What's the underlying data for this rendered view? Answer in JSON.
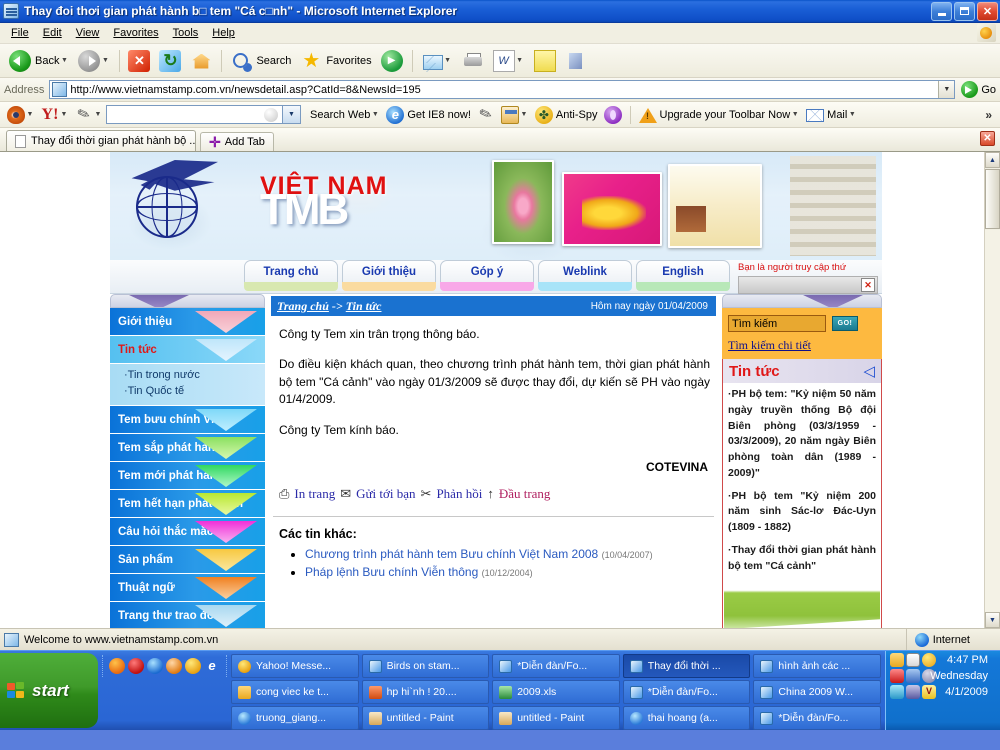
{
  "window": {
    "title": "Thay đoi thơi gian phát hành b□ tem \"Cá c□nh\" - Microsoft Internet Explorer",
    "icon": "ie-document-icon",
    "minimize": "minimize-button",
    "maximize": "maximize-button",
    "close": "close-button"
  },
  "menubar": {
    "items": [
      "File",
      "Edit",
      "View",
      "Favorites",
      "Tools",
      "Help"
    ]
  },
  "toolbar": {
    "back": "Back",
    "search": "Search",
    "favorites": "Favorites",
    "items": [
      {
        "name": "back-button",
        "label": "Back",
        "icon": "back-arrow-icon",
        "dropdown": true
      },
      {
        "name": "forward-button",
        "label": "",
        "icon": "forward-arrow-icon",
        "dropdown": true
      },
      {
        "name": "stop-button",
        "label": "",
        "icon": "stop-icon"
      },
      {
        "name": "refresh-button",
        "label": "",
        "icon": "refresh-icon"
      },
      {
        "name": "home-button",
        "label": "",
        "icon": "home-icon"
      },
      {
        "name": "search-button",
        "label": "Search",
        "icon": "search-icon"
      },
      {
        "name": "favorites-button",
        "label": "Favorites",
        "icon": "star-icon"
      },
      {
        "name": "media-button",
        "label": "",
        "icon": "media-icon"
      },
      {
        "name": "mail-button",
        "label": "",
        "icon": "mail-icon",
        "dropdown": true
      },
      {
        "name": "print-button",
        "label": "",
        "icon": "printer-icon"
      },
      {
        "name": "word-button",
        "label": "",
        "icon": "word-icon",
        "dropdown": true
      },
      {
        "name": "notes-button",
        "label": "",
        "icon": "note-icon"
      },
      {
        "name": "edit-button",
        "label": "",
        "icon": "edit-icon"
      }
    ]
  },
  "address": {
    "label": "Address",
    "url": "http://www.vietnamstamp.com.vn/newsdetail.asp?CatId=8&NewsId=195",
    "go_label": "Go"
  },
  "yahoo_toolbar": {
    "search_placeholder": "",
    "search_value": "",
    "search_web": "Search Web",
    "items": [
      {
        "name": "yahoo-companion-icon",
        "label": ""
      },
      {
        "name": "yahoo-logo-icon",
        "label": ""
      },
      {
        "name": "highlight-pen-icon",
        "label": ""
      },
      {
        "name": "get-ie8-button",
        "label": "Get IE8 now!"
      },
      {
        "name": "pencil-icon",
        "label": ""
      },
      {
        "name": "popup-blocker-icon",
        "label": ""
      },
      {
        "name": "anti-spy-button",
        "label": "Anti-Spy"
      },
      {
        "name": "music-icon",
        "label": ""
      },
      {
        "name": "upgrade-toolbar-button",
        "label": "Upgrade your Toolbar Now"
      },
      {
        "name": "mail-button",
        "label": "Mail"
      }
    ],
    "overflow": "»"
  },
  "tabs": {
    "open": [
      {
        "label": "Thay đổi thời gian phát hành bộ ...",
        "active": true
      }
    ],
    "add_tab": "Add Tab",
    "close_label": "✕"
  },
  "page": {
    "logo": {
      "line1": "VIỆT NAM",
      "line2": "TMB"
    },
    "nav": [
      {
        "label": "Trang chủ",
        "color": "#d8e8b0"
      },
      {
        "label": "Giới thiệu",
        "color": "#fadba0"
      },
      {
        "label": "Góp ý",
        "color": "#f8a8e8"
      },
      {
        "label": "Weblink",
        "color": "#a8e4f8"
      },
      {
        "label": "English",
        "color": "#b8e8b8"
      }
    ],
    "counter_text": "Bạn là người truy cập thứ",
    "counter_broken_image": "✕",
    "sidebar": [
      {
        "label": "Giới thiệu",
        "active": false,
        "arrow": "#f0a8b8"
      },
      {
        "label": "Tin tức",
        "active": true,
        "arrow": "#a8d8f8",
        "sub": [
          "Tin trong nước",
          "Tin Quốc tế"
        ]
      },
      {
        "label": "Tem bưu chính VN",
        "active": false,
        "arrow": "#7fd8f8"
      },
      {
        "label": "Tem sắp phát hành",
        "active": false,
        "arrow": "#8ae060"
      },
      {
        "label": "Tem mới phát hành",
        "active": false,
        "arrow": "#30d860"
      },
      {
        "label": "Tem hết hạn phát hành",
        "active": false,
        "arrow": "#b8e830"
      },
      {
        "label": "Câu hỏi thắc mắc",
        "active": false,
        "arrow": "#f030d8"
      },
      {
        "label": "Sản phẩm",
        "active": false,
        "arrow": "#f8c840"
      },
      {
        "label": "Thuật ngữ",
        "active": false,
        "arrow": "#f08020"
      },
      {
        "label": "Trang thư trao đổi",
        "active": false,
        "arrow": "#a8d8f0"
      }
    ],
    "breadcrumb": {
      "home": "Trang chủ",
      "sep": " -> ",
      "current": "Tin tức"
    },
    "today": "Hôm nay ngày 01/04/2009",
    "article": [
      "Công ty Tem xin trân trọng thông báo.",
      "Do điều kiện khách quan, theo chương trình phát hành tem, thời gian phát hành bộ tem \"Cá cảnh\" vào ngày 01/3/2009 sẽ được thay đổi, dự kiến sẽ PH vào ngày 01/4/2009.",
      "Công ty Tem kính báo."
    ],
    "signature": "COTEVINA",
    "actions": [
      {
        "icon": "printer-icon",
        "glyph": "⎙",
        "label": "In trang",
        "color": "blue"
      },
      {
        "icon": "envelope-icon",
        "glyph": "✉",
        "label": "Gửi tới bạn",
        "color": "blue"
      },
      {
        "icon": "paperclip-icon",
        "glyph": "✂",
        "label": "Phản hồi",
        "color": "blue"
      },
      {
        "icon": "up-arrow-icon",
        "glyph": "↑",
        "label": "Đầu trang",
        "color": "pink"
      }
    ],
    "others_title": "Các tin khác:",
    "others": [
      {
        "label": "Chương trình phát hành tem Bưu chính Việt Nam 2008",
        "date": "(10/04/2007)"
      },
      {
        "label": "Pháp lệnh Bưu chính Viễn thông",
        "date": "(10/12/2004)"
      }
    ],
    "search": {
      "value": "Tìm kiếm",
      "go": "GO!",
      "detail_link": "Tìm kiếm chi tiết"
    },
    "news_panel": {
      "title": "Tin tức",
      "flag_icon": "flag-icon",
      "items": [
        "PH bộ tem: \"Kỷ niệm 50 năm ngày truyền thống Bộ đội Biên phòng (03/3/1959 - 03/3/2009), 20 năm ngày Biên phòng toàn dân (1989 - 2009)\"",
        "PH bộ tem \"Kỷ niệm 200 năm sinh Sác-lơ Đác-Uyn (1809 - 1882)",
        "Thay đổi thời gian phát hành bộ tem \"Cá cảnh\""
      ]
    }
  },
  "statusbar": {
    "text": "Welcome to www.vietnamstamp.com.vn",
    "zone": "Internet"
  },
  "taskbar": {
    "start": "start",
    "quicklaunch": [
      "firefox-icon",
      "opera-icon",
      "ie-icon",
      "realplayer-icon",
      "yahoo-messenger-icon",
      "ie-browser-icon"
    ],
    "buttons": [
      {
        "label": "Yahoo! Messe...",
        "icon": "ym",
        "active": false
      },
      {
        "label": "Birds on stam...",
        "icon": "ie",
        "active": false
      },
      {
        "label": "*Diễn đàn/Fo...",
        "icon": "ie",
        "active": false
      },
      {
        "label": "Thay đổi thời ...",
        "icon": "ie",
        "active": true
      },
      {
        "label": "hình ảnh các ...",
        "icon": "ie",
        "active": false
      },
      {
        "label": "cong viec ke t...",
        "icon": "fold",
        "active": false
      },
      {
        "label": "hp hi`nh ! 20....",
        "icon": "cam",
        "active": false
      },
      {
        "label": "2009.xls",
        "icon": "xls",
        "active": false
      },
      {
        "label": "*Diễn đàn/Fo...",
        "icon": "ie",
        "active": false
      },
      {
        "label": "China 2009 W...",
        "icon": "ie",
        "active": false
      },
      {
        "label": "truong_giang...",
        "icon": "ym2",
        "active": false
      },
      {
        "label": "untitled - Paint",
        "icon": "paint",
        "active": false
      },
      {
        "label": "untitled - Paint",
        "icon": "paint",
        "active": false
      },
      {
        "label": "thai hoang (a...",
        "icon": "ym2",
        "active": false
      },
      {
        "label": "*Diễn đàn/Fo...",
        "icon": "ie",
        "active": false
      }
    ],
    "clock": {
      "time": "4:47 PM",
      "day": "Wednesday",
      "date": "4/1/2009"
    }
  },
  "colors": {
    "titlebar": "#1a5fd6",
    "accent_blue": "#1a72d0",
    "red": "#e01818",
    "orange": "#fdb940",
    "taskbar": "#2a66d4",
    "start_green": "#3f9a2a"
  }
}
